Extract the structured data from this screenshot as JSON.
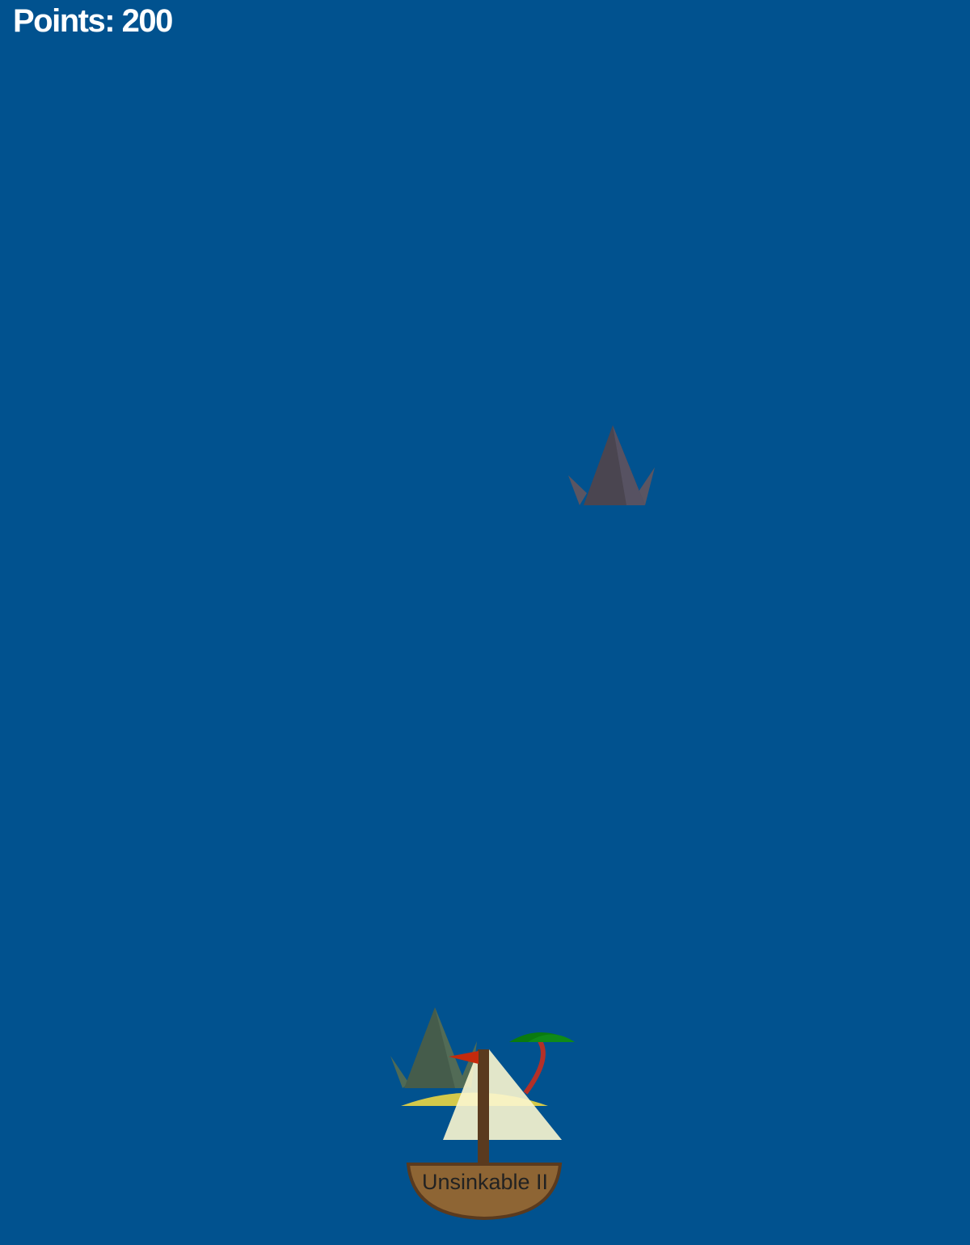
{
  "hud": {
    "points_label": "Points:",
    "points": 200
  },
  "boat": {
    "name": "Unsinkable II"
  },
  "colors": {
    "sea": "#01528f",
    "rock": "#4a4550",
    "island_rock": "#455c4b",
    "sand": "#d4c94a",
    "palm_leaves": "#0a7a10",
    "palm_trunk": "#b33028",
    "hull": "#8e6534",
    "sail": "#fbf6cf",
    "mast": "#5a3a1e",
    "flag": "#c42a0c"
  }
}
